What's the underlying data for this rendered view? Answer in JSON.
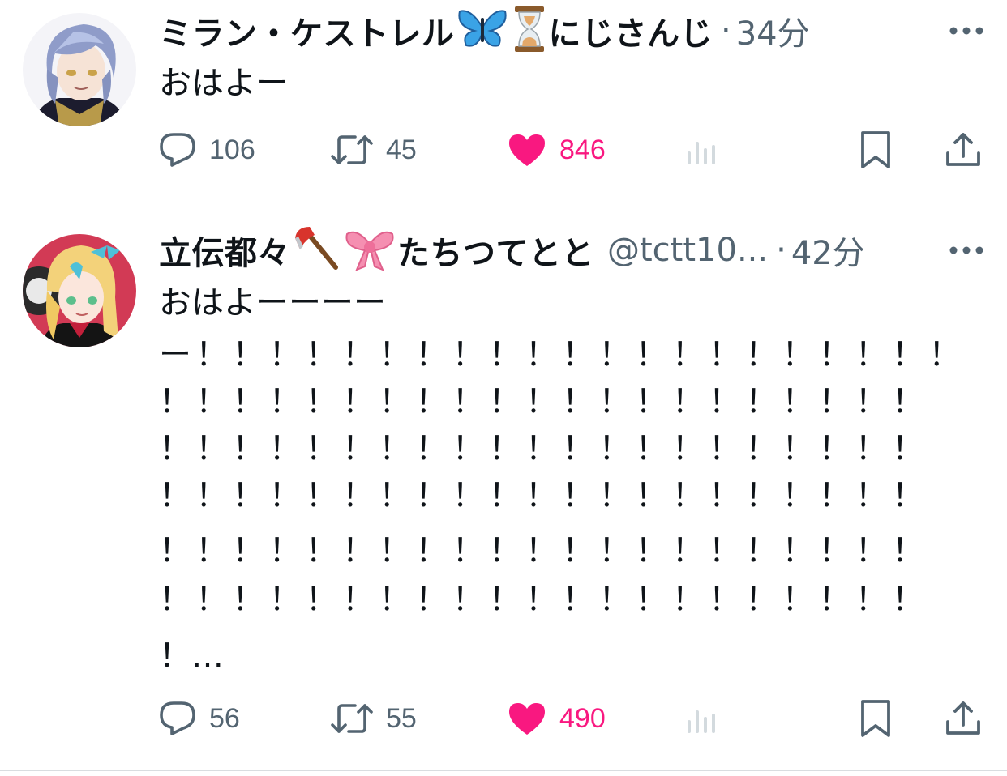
{
  "tweets": [
    {
      "author_name": "ミラン・ケストレル",
      "author_name_suffix": "にじさんじ",
      "emojis": [
        "butterfly-icon",
        "hourglass-icon"
      ],
      "handle": "",
      "separator": "·",
      "time": "34分",
      "body": "おはよー",
      "actions": {
        "replies": "106",
        "retweets": "45",
        "likes": "846"
      },
      "avatar": "avatar-milan"
    },
    {
      "author_name": "立伝都々",
      "author_name_suffix": "たちつてとと",
      "emojis": [
        "axe-icon",
        "ribbon-icon"
      ],
      "handle": "@tctt10...",
      "separator": "·",
      "time": "42分",
      "body_lines": [
        "おはよーーーー",
        "ー！！！！！！！！！！！！！！！！！！！！！",
        "！！！！！！！！！！！！！！！！！！！！！",
        "！！！！！！！！！！！！！！！！！！！！！",
        "！！！！！！！！！！！！！！！！！！！！！",
        "！！！！！！！！！！！！！！！！！！！！！",
        "！！！！！！！！！！！！！！！！！！！！！",
        "！…"
      ],
      "actions": {
        "replies": "56",
        "retweets": "55",
        "likes": "490"
      },
      "avatar": "avatar-tatsutsu"
    }
  ],
  "colors": {
    "text": "#0f1419",
    "muted": "#536471",
    "like": "#f91880",
    "divider": "#d9dde0"
  }
}
